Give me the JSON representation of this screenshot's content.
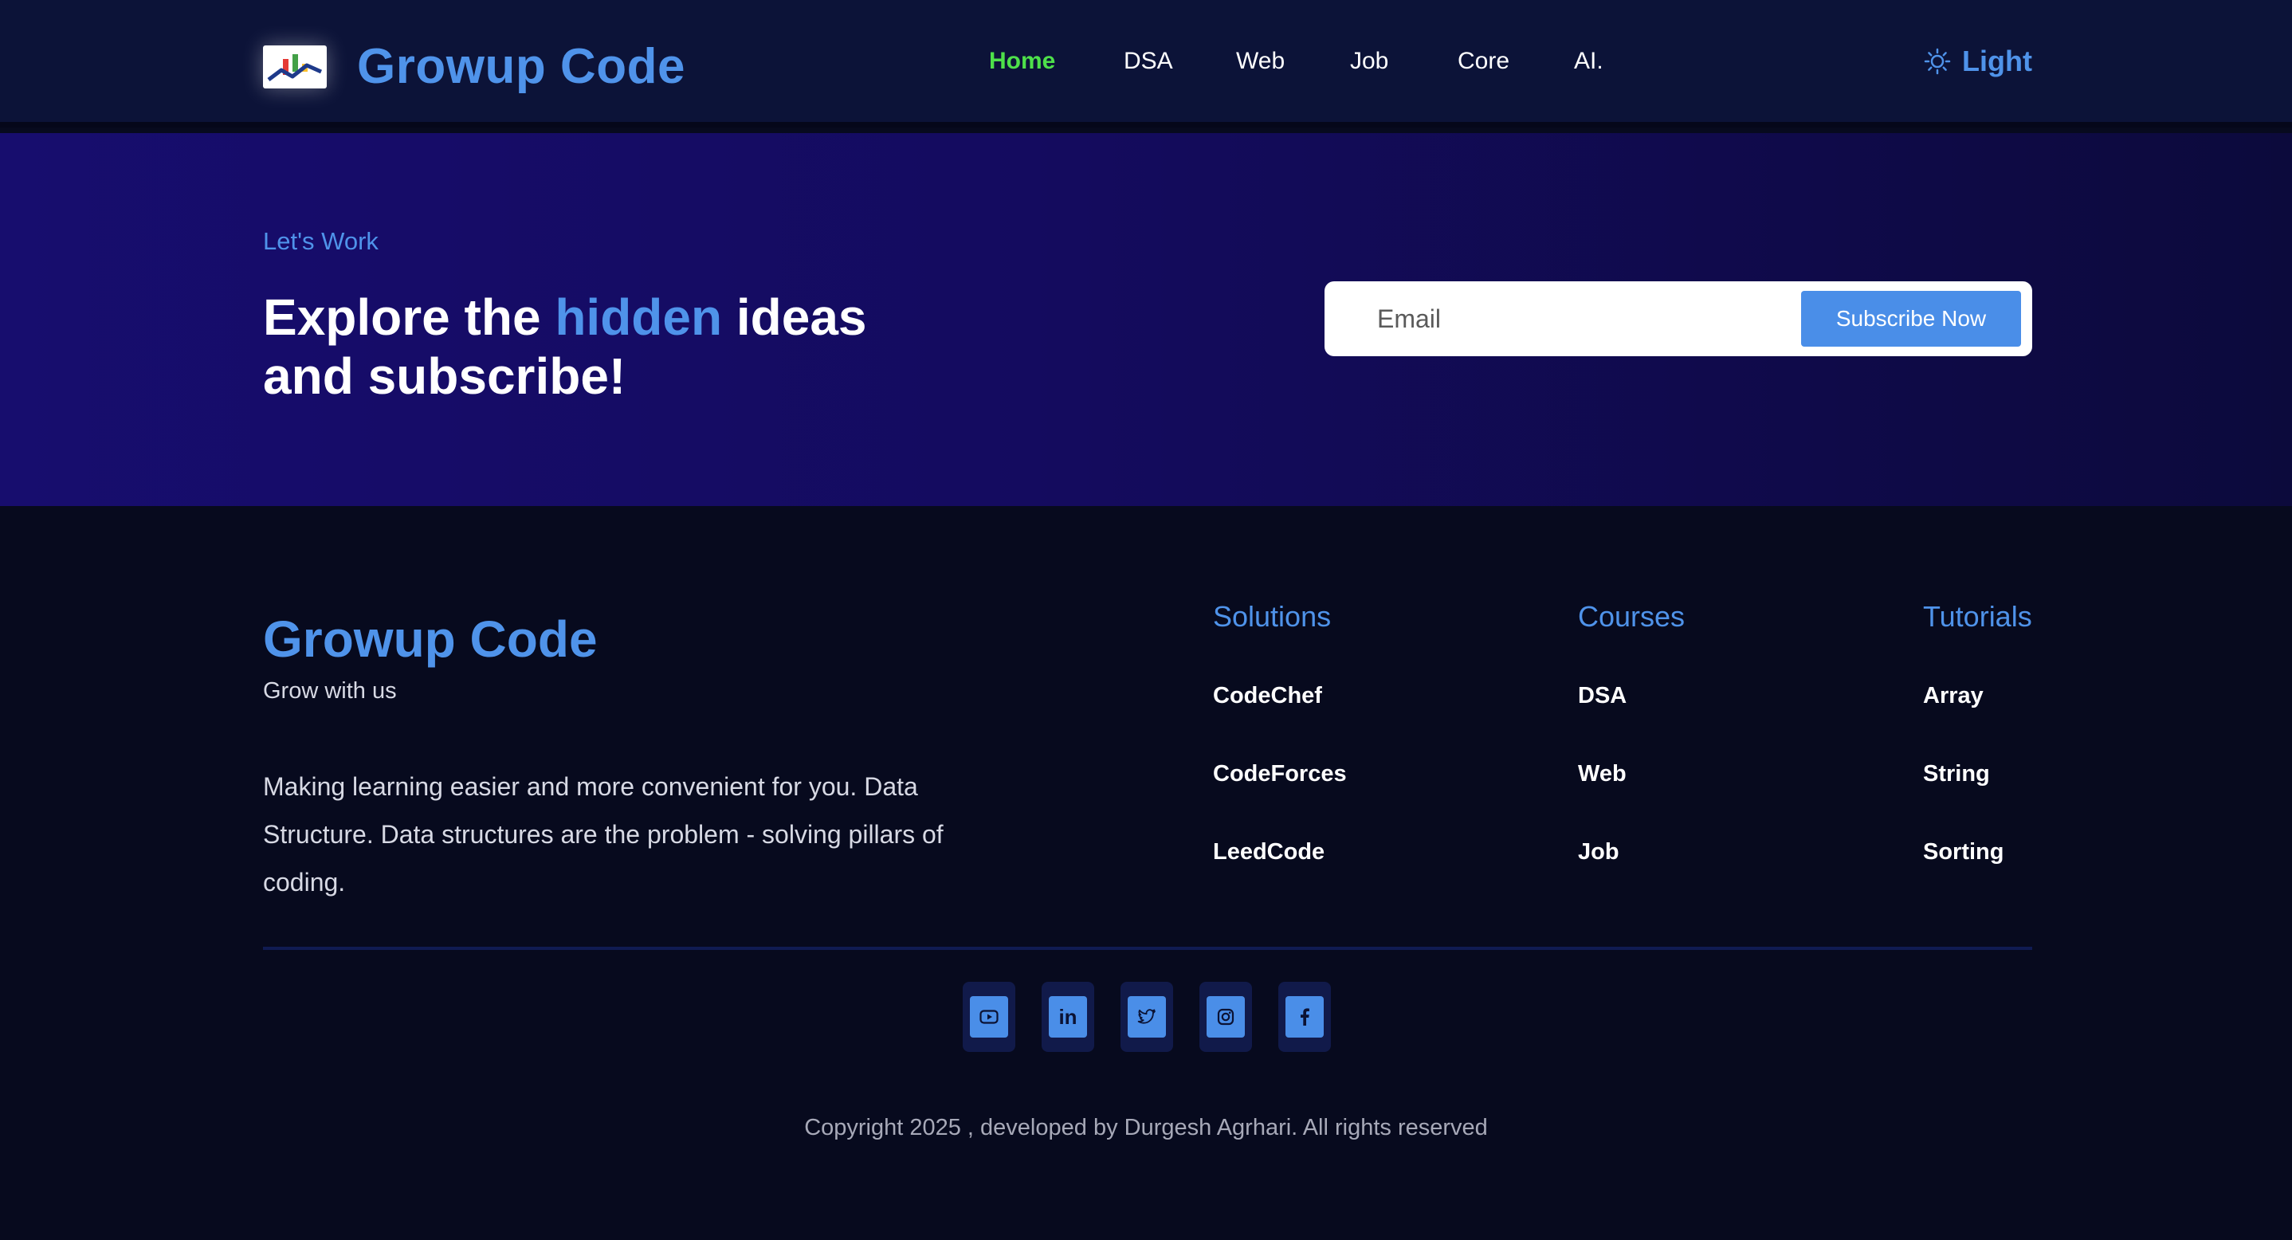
{
  "header": {
    "brand": "Growup Code",
    "nav": [
      {
        "label": "Home",
        "active": true
      },
      {
        "label": "DSA",
        "active": false
      },
      {
        "label": "Web",
        "active": false
      },
      {
        "label": "Job",
        "active": false
      },
      {
        "label": "Core",
        "active": false
      },
      {
        "label": "AI.",
        "active": false
      }
    ],
    "theme_toggle": {
      "label": "Light",
      "icon": "sun-icon"
    }
  },
  "hero": {
    "eyebrow": "Let's Work",
    "title_before": "Explore the ",
    "title_highlight": "hidden",
    "title_after": " ideas and subscribe!",
    "email_placeholder": "Email",
    "email_value": "",
    "subscribe_label": "Subscribe Now"
  },
  "footer": {
    "brand": "Growup Code",
    "tagline": "Grow with us",
    "description": "Making learning easier and more convenient for you. Data Structure. Data structures are the problem - solving pillars of coding.",
    "columns": [
      {
        "title": "Solutions",
        "links": [
          "CodeChef",
          "CodeForces",
          "LeedCode"
        ]
      },
      {
        "title": "Courses",
        "links": [
          "DSA",
          "Web",
          "Job"
        ]
      },
      {
        "title": "Tutorials",
        "links": [
          "Array",
          "String",
          "Sorting"
        ]
      }
    ],
    "socials": [
      "youtube-icon",
      "linkedin-icon",
      "twitter-icon",
      "instagram-icon",
      "facebook-icon"
    ],
    "copyright": "Copyright 2025 , developed by Durgesh Agrhari. All rights reserved"
  },
  "colors": {
    "accent": "#4f93ea",
    "active_nav": "#4ee04a",
    "header_bg": "#0c1338",
    "hero_bg": "#170d6e",
    "footer_bg": "#070a1e"
  }
}
